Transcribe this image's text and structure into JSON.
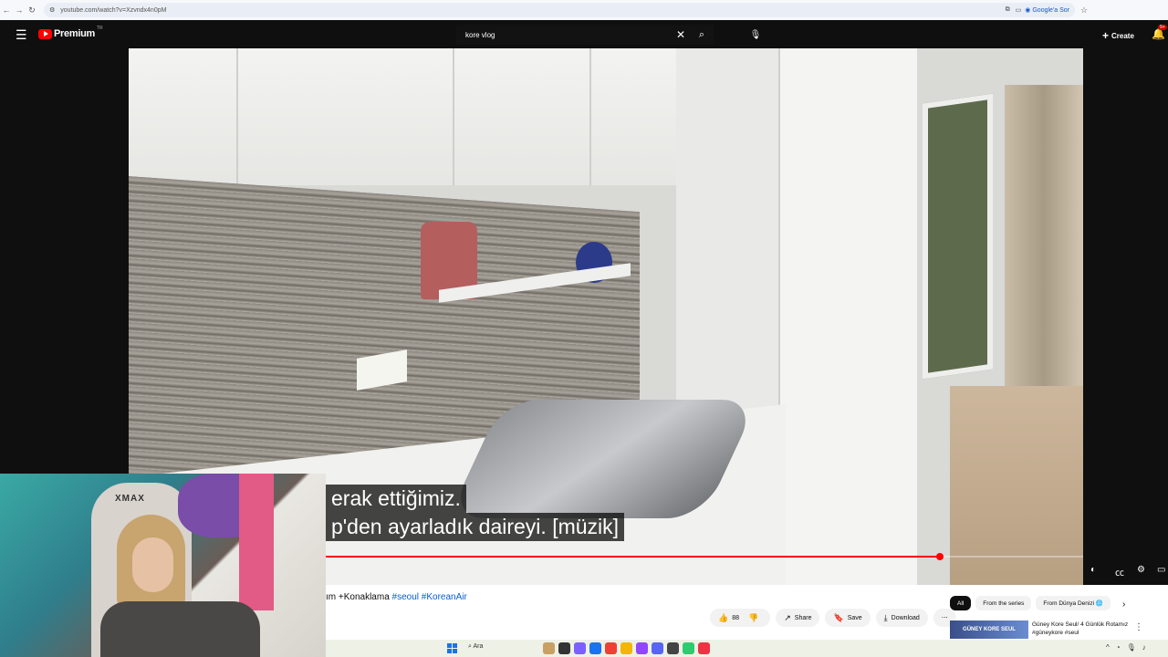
{
  "browser": {
    "url": "youtube.com/watch?v=Xzvndx4n0pM",
    "google_sor": "Google'a Sor"
  },
  "header": {
    "logo_text": "Premium",
    "region": "TR",
    "search_value": "kore vlog",
    "create_label": "Create",
    "notifications": "9+"
  },
  "player": {
    "caption_line1": "erak ettiğimiz.",
    "caption_line2": "p'den ayarladık daireyi. [müzik]",
    "progress": 0.85
  },
  "video": {
    "title_text": "ım +Konaklama ",
    "tag1": "#seoul",
    "tag2": "#KoreanAir",
    "likes": "88",
    "share_label": "Share",
    "save_label": "Save",
    "download_label": "Download"
  },
  "chips": [
    "All",
    "From the series",
    "From Dünya Denizi 🌐"
  ],
  "recommended": {
    "thumb_text": "GÜNEY KORE SEUL",
    "title": "Güney Kore Seul/ 4 Günlük Rotamız #güneykore #seul"
  },
  "taskbar": {
    "search_label": "Ara"
  },
  "colors": {
    "youtube_red": "#ff0000",
    "link_blue": "#065fd4"
  }
}
